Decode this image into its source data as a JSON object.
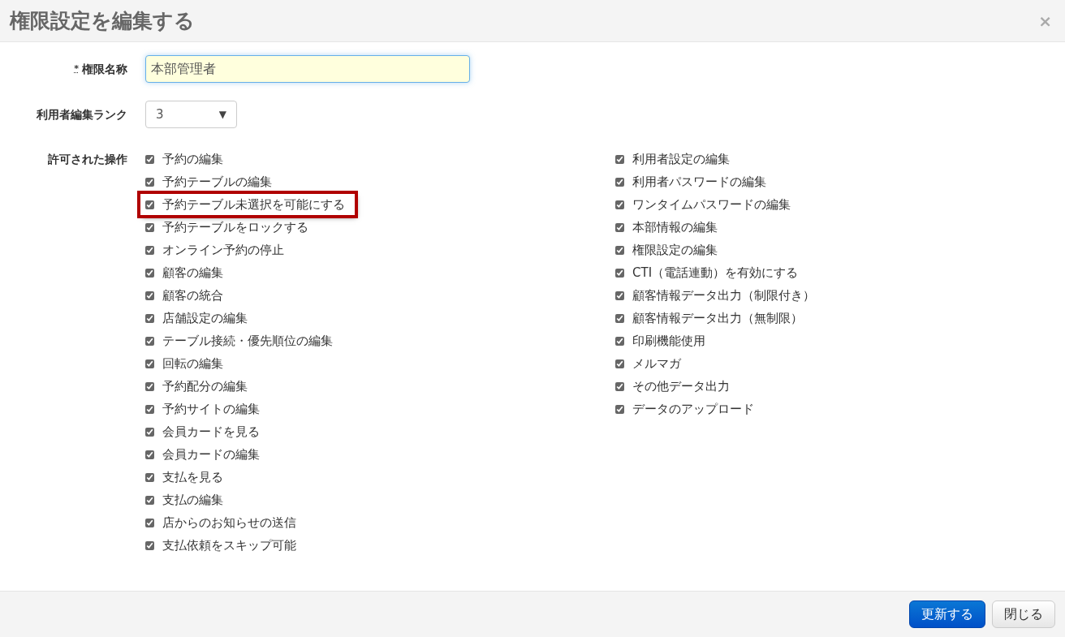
{
  "dialog": {
    "title": "権限設定を編集する",
    "close": "×"
  },
  "fields": [
    {
      "kind": "text",
      "label": "権限名称",
      "required_mark": "*",
      "value": "本部管理者"
    },
    {
      "kind": "select",
      "label": "利用者編集ランク",
      "value": "3",
      "caret": "▼"
    }
  ],
  "permissions": {
    "label": "許可された操作",
    "columns": [
      [
        {
          "label": "予約の編集",
          "checked": true,
          "highlighted": false
        },
        {
          "label": "予約テーブルの編集",
          "checked": true,
          "highlighted": false
        },
        {
          "label": "予約テーブル未選択を可能にする",
          "checked": true,
          "highlighted": true
        },
        {
          "label": "予約テーブルをロックする",
          "checked": true,
          "highlighted": false
        },
        {
          "label": "オンライン予約の停止",
          "checked": true,
          "highlighted": false
        },
        {
          "label": "顧客の編集",
          "checked": true,
          "highlighted": false
        },
        {
          "label": "顧客の統合",
          "checked": true,
          "highlighted": false
        },
        {
          "label": "店舗設定の編集",
          "checked": true,
          "highlighted": false
        },
        {
          "label": "テーブル接続・優先順位の編集",
          "checked": true,
          "highlighted": false
        },
        {
          "label": "回転の編集",
          "checked": true,
          "highlighted": false
        },
        {
          "label": "予約配分の編集",
          "checked": true,
          "highlighted": false
        },
        {
          "label": "予約サイトの編集",
          "checked": true,
          "highlighted": false
        },
        {
          "label": "会員カードを見る",
          "checked": true,
          "highlighted": false
        },
        {
          "label": "会員カードの編集",
          "checked": true,
          "highlighted": false
        },
        {
          "label": "支払を見る",
          "checked": true,
          "highlighted": false
        },
        {
          "label": "支払の編集",
          "checked": true,
          "highlighted": false
        },
        {
          "label": "店からのお知らせの送信",
          "checked": true,
          "highlighted": false
        },
        {
          "label": "支払依頼をスキップ可能",
          "checked": true,
          "highlighted": false
        }
      ],
      [
        {
          "label": "利用者設定の編集",
          "checked": true,
          "highlighted": false
        },
        {
          "label": "利用者パスワードの編集",
          "checked": true,
          "highlighted": false
        },
        {
          "label": "ワンタイムパスワードの編集",
          "checked": true,
          "highlighted": false
        },
        {
          "label": "本部情報の編集",
          "checked": true,
          "highlighted": false
        },
        {
          "label": "権限設定の編集",
          "checked": true,
          "highlighted": false
        },
        {
          "label": "CTI（電話連動）を有効にする",
          "checked": true,
          "highlighted": false
        },
        {
          "label": "顧客情報データ出力（制限付き）",
          "checked": true,
          "highlighted": false
        },
        {
          "label": "顧客情報データ出力（無制限）",
          "checked": true,
          "highlighted": false
        },
        {
          "label": "印刷機能使用",
          "checked": true,
          "highlighted": false
        },
        {
          "label": "メルマガ",
          "checked": true,
          "highlighted": false
        },
        {
          "label": "その他データ出力",
          "checked": true,
          "highlighted": false
        },
        {
          "label": "データのアップロード",
          "checked": true,
          "highlighted": false
        }
      ]
    ]
  },
  "buttons": [
    {
      "label": "更新する",
      "kind": "primary"
    },
    {
      "label": "閉じる",
      "kind": "secondary"
    }
  ]
}
